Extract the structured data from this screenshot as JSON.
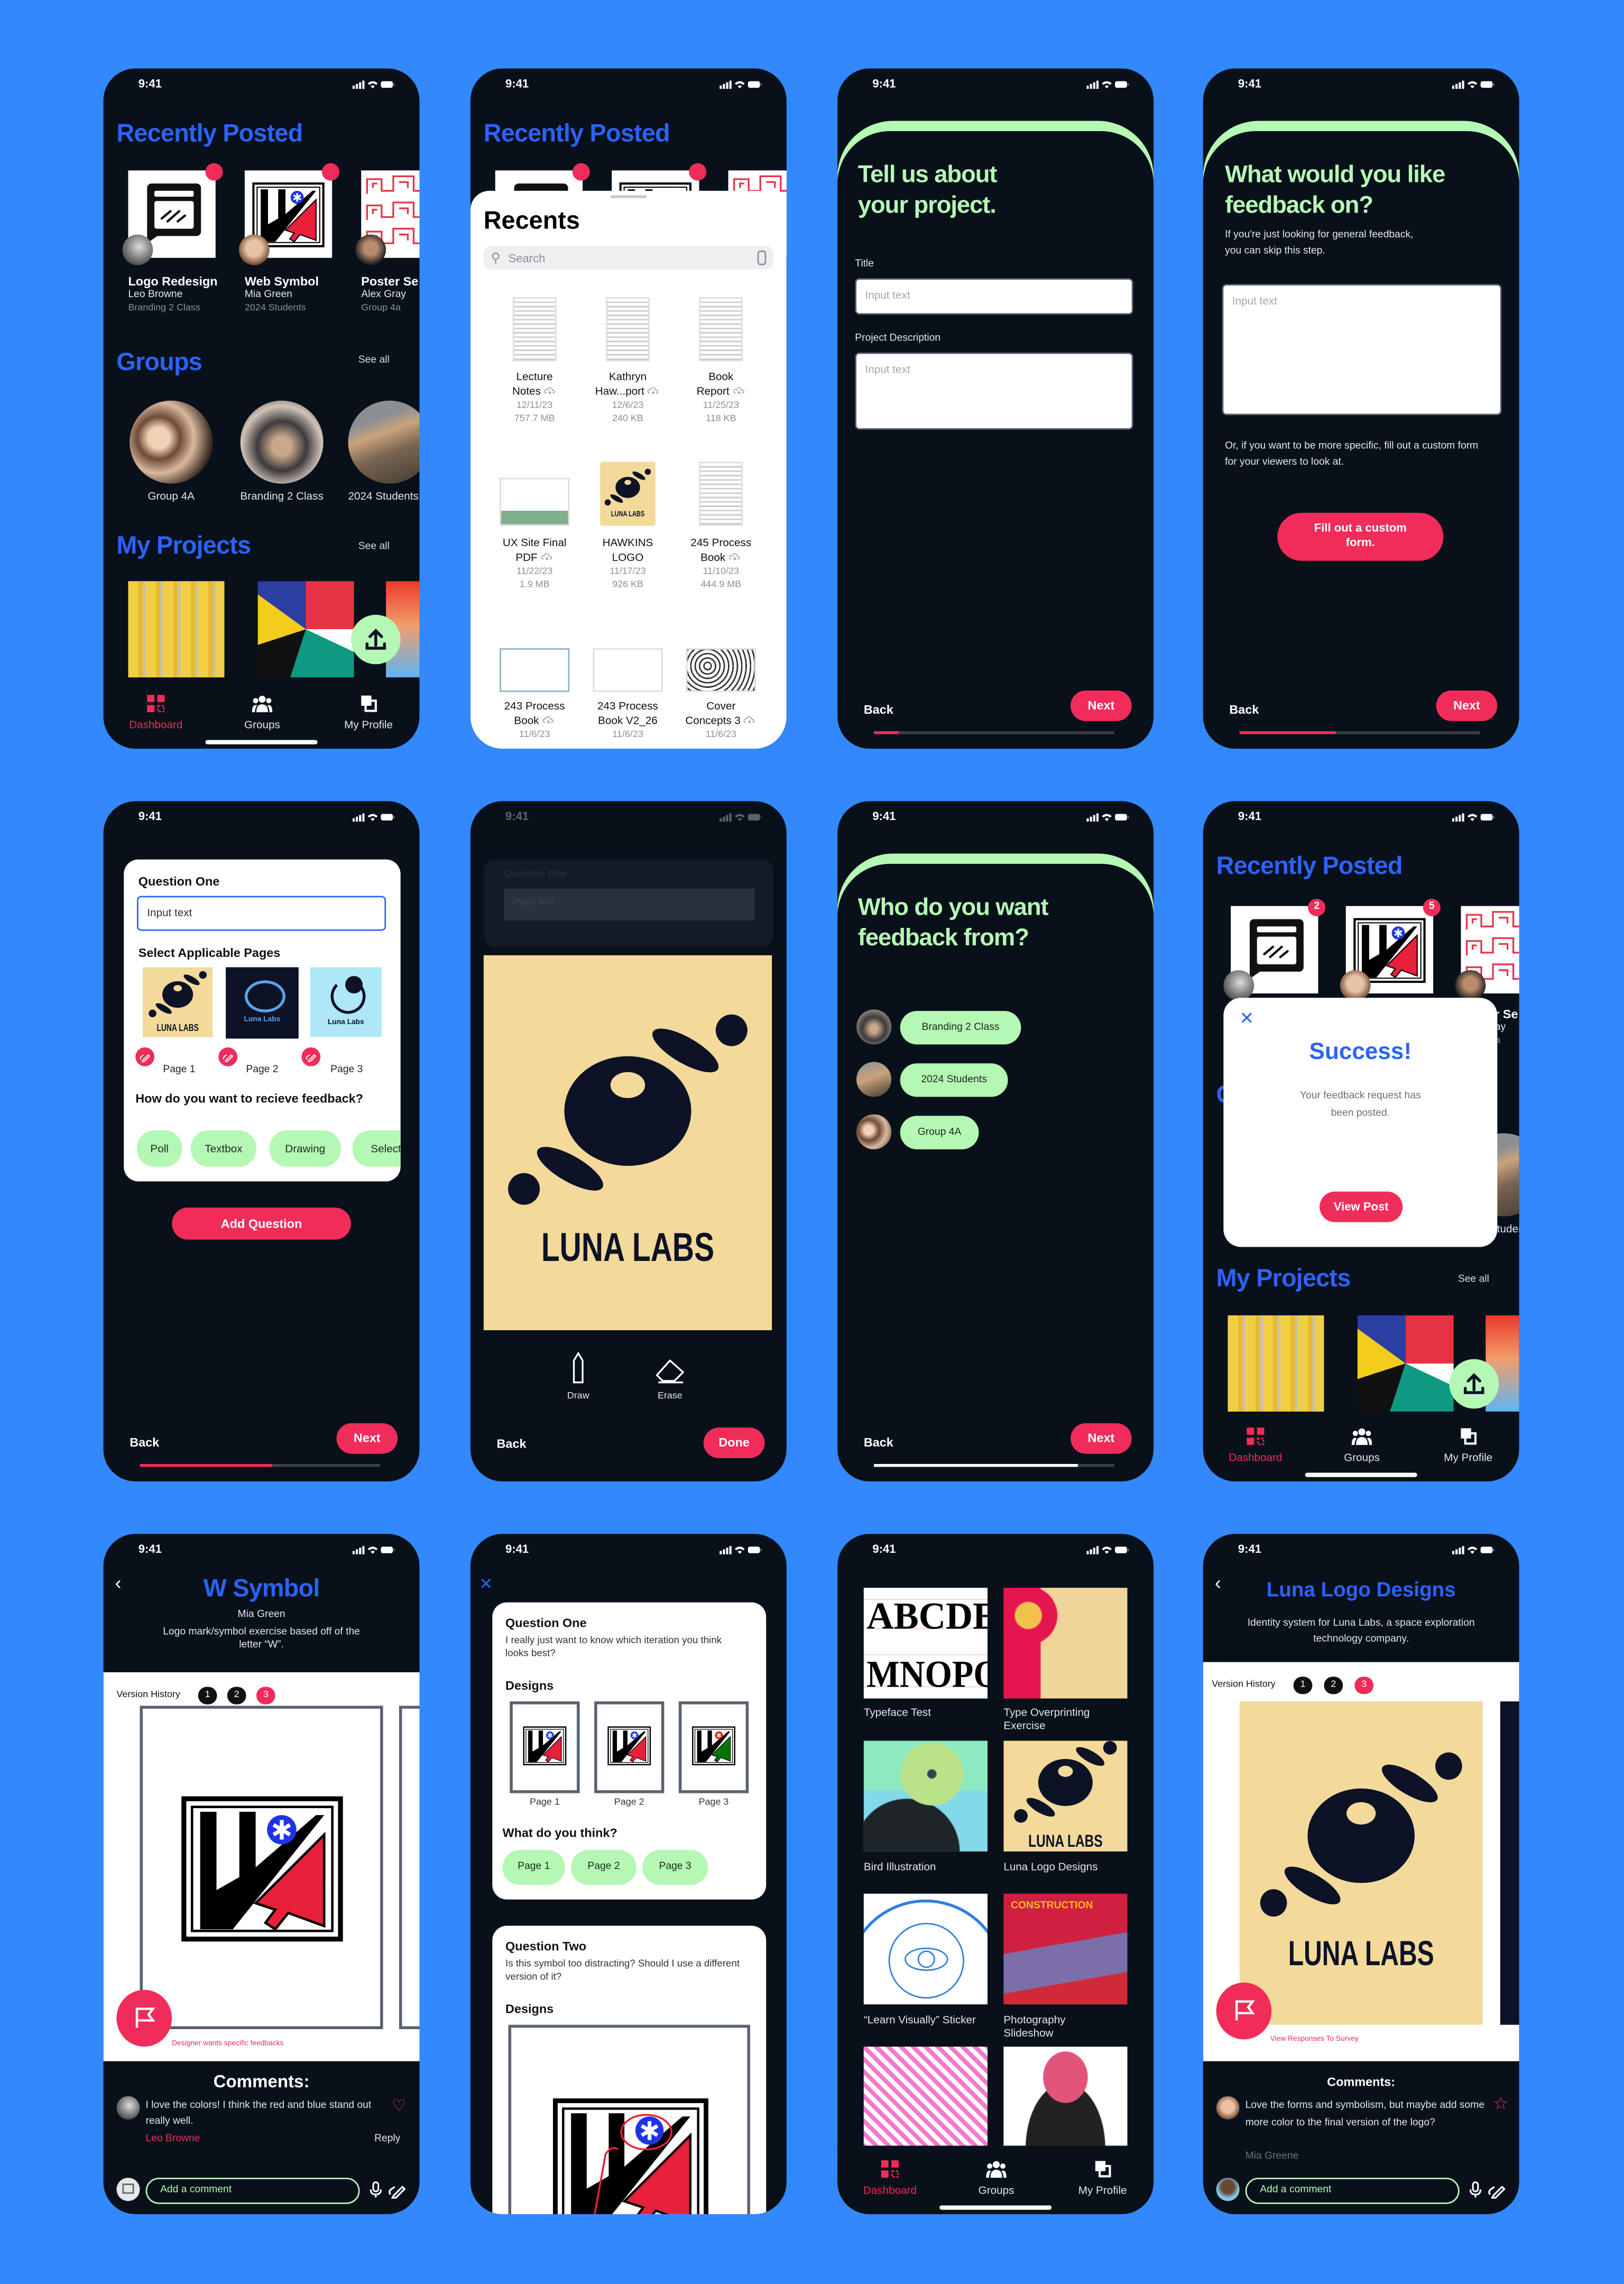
{
  "colors": {
    "background": "#3388fc",
    "phone": "#08101a",
    "accent_blue": "#2b63f6",
    "accent_pink": "#f02c5a",
    "accent_green": "#b5f8b4"
  },
  "status": {
    "time": "9:41"
  },
  "logos": {
    "luna": "LUNA LABS",
    "luna_alt": "Luna Labs",
    "construction": "CONSTRUCTION",
    "typeface_row1": "ABCDE",
    "typeface_row2": "MNOPQ"
  },
  "tabbar": {
    "dashboard": "Dashboard",
    "groups": "Groups",
    "profile": "My Profile"
  },
  "dashboard": {
    "title": "Recently Posted",
    "posts": [
      {
        "title": "Logo Redesign",
        "author": "Leo Browne",
        "group": "Branding 2 Class",
        "badge": "2"
      },
      {
        "title": "Web Symbol",
        "author": "Mia Green",
        "group": "2024 Students",
        "badge": "5"
      },
      {
        "title": "Poster Se",
        "author": "Alex Gray",
        "group": "Group 4a"
      }
    ],
    "groups_title": "Groups",
    "see_all": "See all",
    "groups": [
      "Group 4A",
      "Branding 2 Class",
      "2024 Students"
    ],
    "projects_title": "My Projects"
  },
  "recents": {
    "title": "Recents",
    "search_placeholder": "Search",
    "files": [
      {
        "name1": "Lecture",
        "name2": "Notes",
        "cloud": true,
        "date": "12/11/23",
        "size": "757.7 MB",
        "thumb": "doc"
      },
      {
        "name1": "Kathryn",
        "name2": "Haw...port",
        "cloud": true,
        "date": "12/6/23",
        "size": "240 KB",
        "thumb": "doc"
      },
      {
        "name1": "Book",
        "name2": "Report",
        "cloud": true,
        "date": "11/25/23",
        "size": "118 KB",
        "thumb": "doc"
      },
      {
        "name1": "UX Site Final",
        "name2": "PDF",
        "cloud": true,
        "date": "11/22/23",
        "size": "1.9 MB",
        "thumb": "ux"
      },
      {
        "name1": "HAWKINS",
        "name2": "LOGO",
        "cloud": false,
        "date": "11/17/23",
        "size": "926 KB",
        "thumb": "luna"
      },
      {
        "name1": "245 Process",
        "name2": "Book",
        "cloud": true,
        "date": "11/10/23",
        "size": "444.9 MB",
        "thumb": "doc"
      },
      {
        "name1": "243 Process",
        "name2": "Book",
        "cloud": true,
        "date": "11/6/23",
        "size": "",
        "thumb": "land"
      },
      {
        "name1": "243 Process",
        "name2": "Book V2_26",
        "cloud": false,
        "date": "11/6/23",
        "size": "",
        "thumb": "land"
      },
      {
        "name1": "Cover",
        "name2": "Concepts 3",
        "cloud": true,
        "date": "11/6/23",
        "size": "",
        "thumb": "sketch"
      }
    ]
  },
  "about": {
    "heading1": "Tell us about",
    "heading2": "your project.",
    "title_label": "Title",
    "title_placeholder": "Input text",
    "desc_label": "Project Description",
    "desc_placeholder": "Input text",
    "back": "Back",
    "next": "Next",
    "progress": 0.1
  },
  "feedback_on": {
    "heading1": "What would you like",
    "heading2": "feedback on?",
    "sub": "If you're just looking for general feedback, you can skip this step.",
    "placeholder": "Input text",
    "or_text": "Or, if you want to be more specific, fill out a custom form for your viewers to look at.",
    "custom_button": "Fill out a custom form.",
    "back": "Back",
    "next": "Next",
    "progress": 0.4
  },
  "question_builder": {
    "question_title": "Question One",
    "input_value": "Input text",
    "select_pages": "Select Applicable Pages",
    "pages": [
      "Page 1",
      "Page 2",
      "Page 3"
    ],
    "how_label": "How do you want to recieve feedback?",
    "types": [
      "Poll",
      "Textbox",
      "Drawing",
      "Select"
    ],
    "add_question": "Add Question",
    "back": "Back",
    "next": "Next",
    "progress": 0.55
  },
  "drawing": {
    "question_title": "Question One",
    "input_value": "Input text",
    "draw": "Draw",
    "erase": "Erase",
    "back": "Back",
    "done": "Done"
  },
  "feedback_from": {
    "heading1": "Who do you want",
    "heading2": "feedback from?",
    "groups": [
      "Branding 2 Class",
      "2024 Students",
      "Group 4A"
    ],
    "back": "Back",
    "next": "Next",
    "progress": 0.85
  },
  "success": {
    "title": "Success!",
    "message": "Your feedback request has been posted.",
    "view_post": "View Post"
  },
  "w_symbol": {
    "title": "W Symbol",
    "author": "Mia Green",
    "description": "Logo mark/symbol exercise based off of the letter “W”.",
    "version_label": "Version History",
    "versions": [
      "1",
      "2",
      "3"
    ],
    "active_version": "3",
    "flag_caption": "Designer wants specific feedbacks",
    "comments_title": "Comments:",
    "comment": {
      "text": "I love the colors! I think the red and blue stand out really well.",
      "author": "Leo Browne",
      "reply": "Reply"
    },
    "add_comment_placeholder": "Add a comment"
  },
  "survey": {
    "q1": {
      "title": "Question One",
      "text": "I really just want to know which iteration you think looks best?",
      "designs_label": "Designs",
      "pages": [
        "Page 1",
        "Page 2",
        "Page 3"
      ],
      "think_label": "What do you think?",
      "options": [
        "Page 1",
        "Page 2",
        "Page 3"
      ]
    },
    "q2": {
      "title": "Question Two",
      "text": "Is this symbol too distracting? Should I use a different version of it?",
      "designs_label": "Designs"
    }
  },
  "gallery": {
    "items": [
      "Typeface Test",
      "Type Overprinting Exercise",
      "Bird Illustration",
      "Luna Logo Designs",
      "“Learn Visually” Sticker",
      "Photography Slideshow"
    ]
  },
  "luna_project": {
    "title": "Luna Logo Designs",
    "description": "Identity system for Luna Labs, a space exploration technology company.",
    "version_label": "Version History",
    "versions": [
      "1",
      "2",
      "3"
    ],
    "active_version": "3",
    "flag_caption": "View Responses To Survey",
    "comments_title": "Comments:",
    "comment": {
      "text": "Love the forms and symbolism, but maybe add some more color to the final version of the logo?",
      "author": "Mia Greene"
    },
    "add_comment_placeholder": "Add a comment"
  }
}
